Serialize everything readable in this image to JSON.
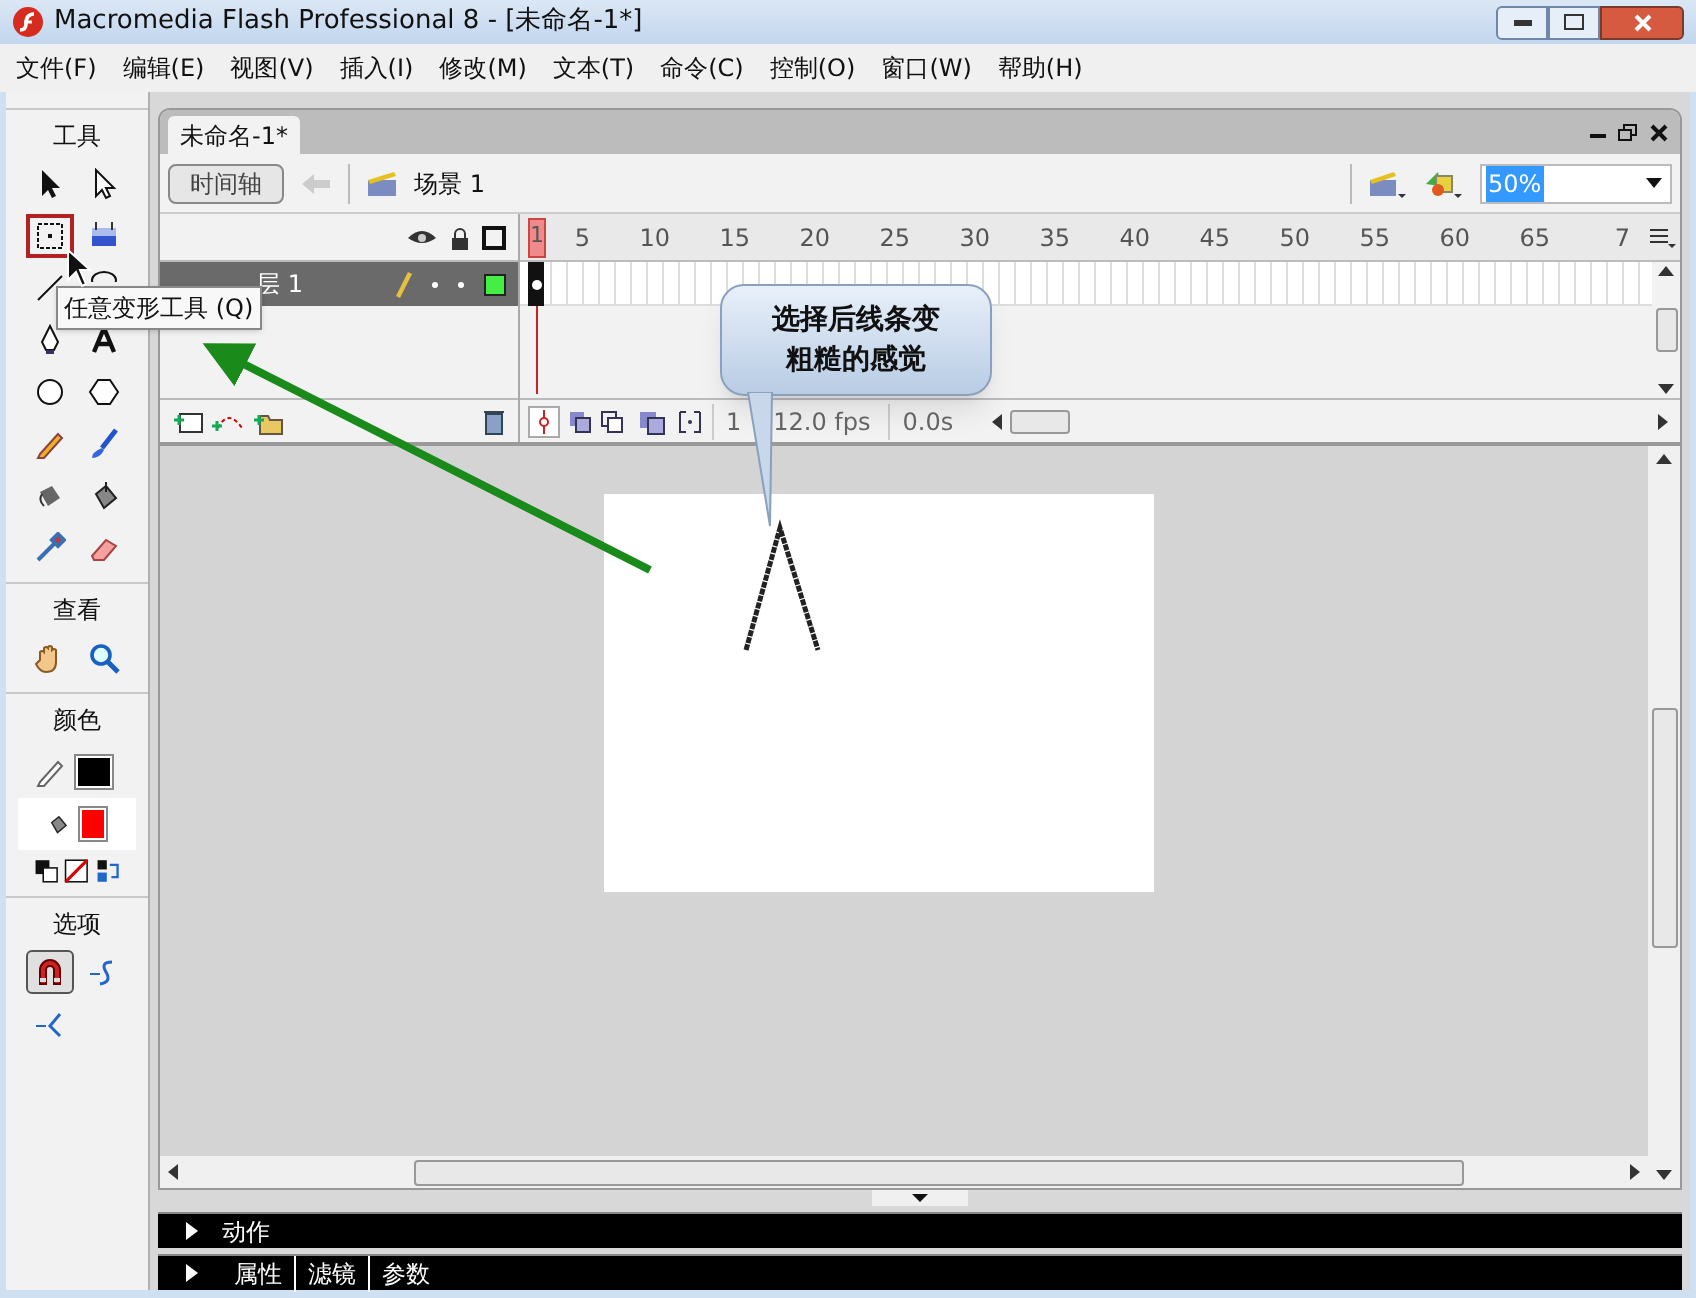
{
  "window": {
    "title": "Macromedia Flash Professional 8 - [未命名-1*]"
  },
  "menu": [
    "文件(F)",
    "编辑(E)",
    "视图(V)",
    "插入(I)",
    "修改(M)",
    "文本(T)",
    "命令(C)",
    "控制(O)",
    "窗口(W)",
    "帮助(H)"
  ],
  "toolbox": {
    "sections": [
      {
        "heading": "工具",
        "tools": [
          {
            "kind": "arrow",
            "selected": false
          },
          {
            "kind": "subselect",
            "selected": false
          },
          {
            "kind": "transform",
            "selected": true
          },
          {
            "kind": "gradient",
            "selected": false
          },
          {
            "kind": "line",
            "selected": false
          },
          {
            "kind": "lasso",
            "selected": false
          },
          {
            "kind": "pen",
            "selected": false
          },
          {
            "kind": "text",
            "selected": false
          },
          {
            "kind": "oval",
            "selected": false
          },
          {
            "kind": "polygon",
            "selected": false
          },
          {
            "kind": "pencil",
            "selected": false
          },
          {
            "kind": "brush",
            "selected": false
          },
          {
            "kind": "ink",
            "selected": false
          },
          {
            "kind": "bucket",
            "selected": false
          },
          {
            "kind": "dropper",
            "selected": false
          },
          {
            "kind": "eraser",
            "selected": false
          }
        ]
      },
      {
        "heading": "查看",
        "tools": [
          {
            "kind": "hand",
            "selected": false
          },
          {
            "kind": "zoom",
            "selected": false
          }
        ]
      },
      {
        "heading": "颜色",
        "swatches": [
          {
            "kind": "stroke",
            "color": "#000000"
          },
          {
            "kind": "fill",
            "color": "#ff0000"
          }
        ]
      },
      {
        "heading": "选项",
        "tools": [
          {
            "kind": "magnet",
            "selected": true
          },
          {
            "kind": "smooth",
            "selected": false
          },
          {
            "kind": "straighten",
            "selected": false
          }
        ]
      }
    ],
    "tooltip": "任意变形工具 (Q)"
  },
  "document": {
    "tab": "未命名-1*",
    "timeline_button": "时间轴",
    "scene": "场景 1",
    "zoom": "50%"
  },
  "timeline": {
    "playhead": "1",
    "ruler": [
      "5",
      "10",
      "15",
      "20",
      "25",
      "30",
      "35",
      "40",
      "45",
      "50",
      "55",
      "60",
      "65",
      "7"
    ],
    "layers": [
      {
        "name": "层 1",
        "selected": true,
        "color": "#44ee44"
      }
    ],
    "status": [
      "1",
      "12.0 fps",
      "0.0s"
    ]
  },
  "callout": "选择后线条变粗糙的感觉",
  "panels": [
    {
      "tabs": [
        "动作"
      ]
    },
    {
      "tabs": [
        "属性",
        "滤镜",
        "参数"
      ]
    }
  ]
}
